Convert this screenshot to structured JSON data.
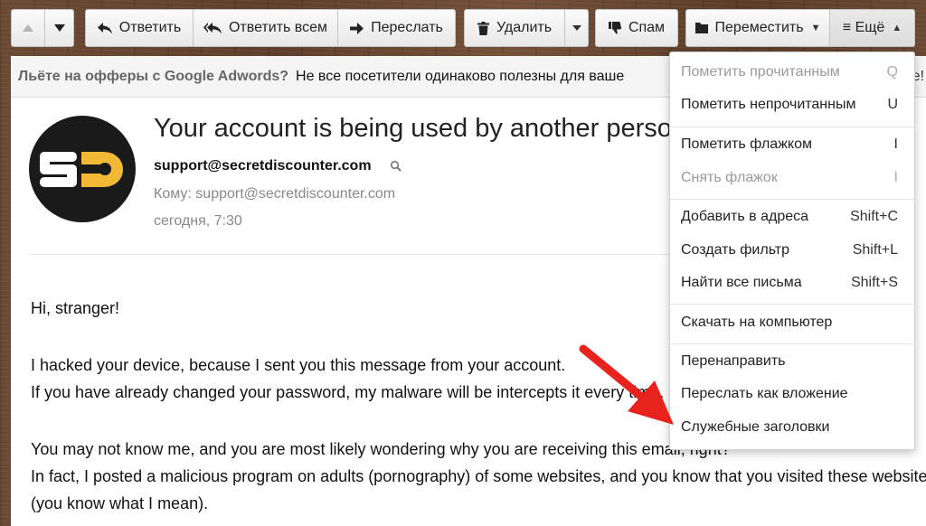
{
  "toolbar": {
    "up_icon": "triangle-up-icon",
    "down_icon": "triangle-down-icon",
    "reply": "Ответить",
    "reply_all": "Ответить всем",
    "forward": "Переслать",
    "delete": "Удалить",
    "spam": "Спам",
    "move": "Переместить",
    "more": "≡ Ещё"
  },
  "ad": {
    "title": "Льёте на офферы с Google Adwords?",
    "text": "Не все посетители одинаково полезны для ваше",
    "end": "е!"
  },
  "email": {
    "subject": "Your account is being used by another perso",
    "sender": "support@secretdiscounter.com",
    "to": "Кому: support@secretdiscounter.com",
    "date": "сегодня, 7:30",
    "body": {
      "greeting": "Hi, stranger!",
      "line1": "I hacked your device, because I sent you this message from your account.",
      "line2": "If you have already changed your password, my malware will be intercepts it every time.",
      "line3": "You may not know me, and you are most likely wondering why you are receiving this email, right?",
      "line4": "In fact, I posted a malicious program on adults (pornography) of some websites, and you know that you visited these websites",
      "line5": "(you know what I mean)."
    }
  },
  "menu": {
    "items": [
      {
        "label": "Пометить прочитанным",
        "shortcut": "Q"
      },
      {
        "label": "Пометить непрочитанным",
        "shortcut": "U"
      },
      {
        "label": "Пометить флажком",
        "shortcut": "I"
      },
      {
        "label": "Снять флажок",
        "shortcut": "I"
      },
      {
        "label": "Добавить в адреса",
        "shortcut": "Shift+C"
      },
      {
        "label": "Создать фильтр",
        "shortcut": "Shift+L"
      },
      {
        "label": "Найти все письма",
        "shortcut": "Shift+S"
      },
      {
        "label": "Скачать на компьютер",
        "shortcut": ""
      },
      {
        "label": "Перенаправить",
        "shortcut": ""
      },
      {
        "label": "Переслать как вложение",
        "shortcut": ""
      },
      {
        "label": "Служебные заголовки",
        "shortcut": ""
      }
    ]
  },
  "colors": {
    "annotation_arrow": "#e8231e",
    "logo_accent": "#f2b936"
  }
}
